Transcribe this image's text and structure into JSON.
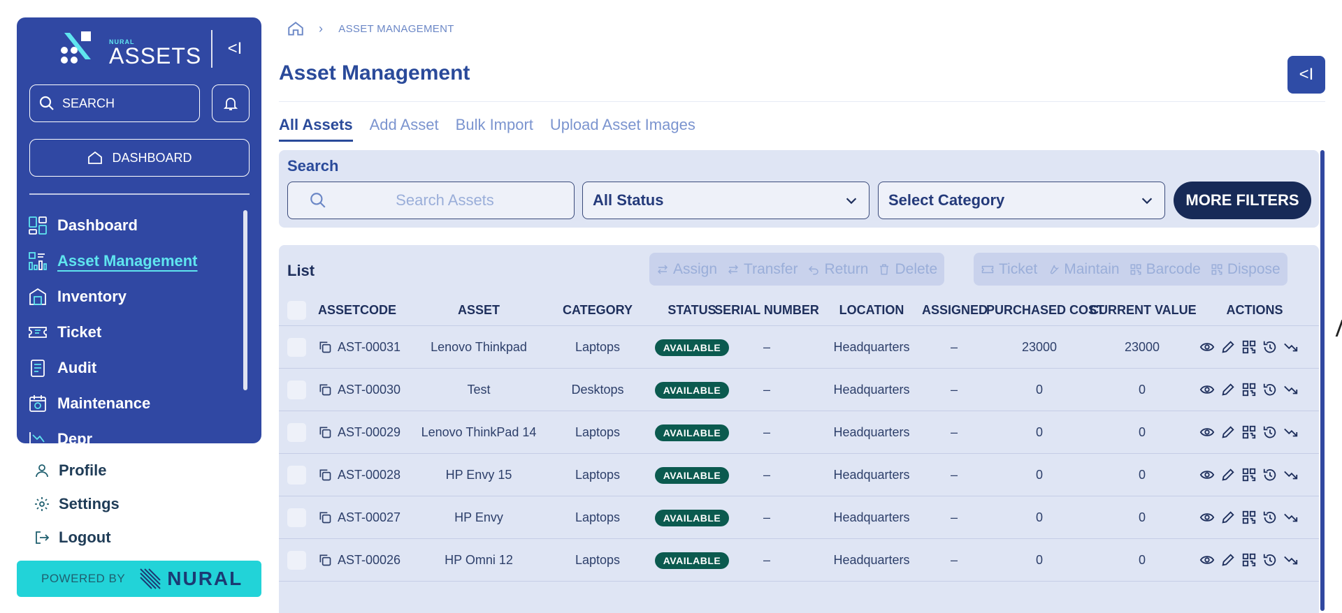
{
  "sidebar": {
    "logo_small": "NURAL",
    "logo_big": "ASSETS",
    "collapse_icon": "<I",
    "search_label": "SEARCH",
    "dashboard_button": "DASHBOARD",
    "items": [
      {
        "label": "Dashboard",
        "icon": "dashboard-icon"
      },
      {
        "label": "Asset Management",
        "icon": "asset-management-icon",
        "active": true
      },
      {
        "label": "Inventory",
        "icon": "inventory-icon"
      },
      {
        "label": "Ticket",
        "icon": "ticket-icon"
      },
      {
        "label": "Audit",
        "icon": "audit-icon"
      },
      {
        "label": "Maintenance",
        "icon": "maintenance-icon"
      },
      {
        "label": "Depr",
        "icon": "depreciation-icon"
      }
    ]
  },
  "bottom_links": [
    {
      "label": "Profile",
      "icon": "user-icon"
    },
    {
      "label": "Settings",
      "icon": "gear-icon"
    },
    {
      "label": "Logout",
      "icon": "logout-icon"
    }
  ],
  "powered": {
    "label": "POWERED BY",
    "brand": "NURAL"
  },
  "breadcrumb": {
    "current": "ASSET MANAGEMENT"
  },
  "page_title": "Asset Management",
  "top_right_icon": "<I",
  "tabs": [
    {
      "label": "All Assets",
      "active": true
    },
    {
      "label": "Add Asset"
    },
    {
      "label": "Bulk Import"
    },
    {
      "label": "Upload Asset Images"
    }
  ],
  "search": {
    "label": "Search",
    "placeholder": "Search Assets",
    "status_select": "All Status",
    "category_select": "Select Category",
    "more_filters": "MORE FILTERS"
  },
  "list": {
    "label": "List",
    "toolbar_a": [
      "Assign",
      "Transfer",
      "Return",
      "Delete"
    ],
    "toolbar_b": [
      "Ticket",
      "Maintain",
      "Barcode",
      "Dispose"
    ],
    "columns": [
      "ASSETCODE",
      "ASSET",
      "CATEGORY",
      "STATUS",
      "SERIAL NUMBER",
      "LOCATION",
      "ASSIGNED",
      "PURCHASED COST",
      "CURRENT VALUE",
      "ACTIONS"
    ],
    "rows": [
      {
        "code": "AST-00031",
        "asset": "Lenovo Thinkpad",
        "category": "Laptops",
        "status": "AVAILABLE",
        "serial": "–",
        "location": "Headquarters",
        "assigned": "–",
        "purchased": "23000",
        "current": "23000"
      },
      {
        "code": "AST-00030",
        "asset": "Test",
        "category": "Desktops",
        "status": "AVAILABLE",
        "serial": "–",
        "location": "Headquarters",
        "assigned": "–",
        "purchased": "0",
        "current": "0"
      },
      {
        "code": "AST-00029",
        "asset": "Lenovo ThinkPad 14",
        "category": "Laptops",
        "status": "AVAILABLE",
        "serial": "–",
        "location": "Headquarters",
        "assigned": "–",
        "purchased": "0",
        "current": "0"
      },
      {
        "code": "AST-00028",
        "asset": "HP Envy 15",
        "category": "Laptops",
        "status": "AVAILABLE",
        "serial": "–",
        "location": "Headquarters",
        "assigned": "–",
        "purchased": "0",
        "current": "0"
      },
      {
        "code": "AST-00027",
        "asset": "HP Envy",
        "category": "Laptops",
        "status": "AVAILABLE",
        "serial": "–",
        "location": "Headquarters",
        "assigned": "–",
        "purchased": "0",
        "current": "0"
      },
      {
        "code": "AST-00026",
        "asset": "HP Omni 12",
        "category": "Laptops",
        "status": "AVAILABLE",
        "serial": "–",
        "location": "Headquarters",
        "assigned": "–",
        "purchased": "0",
        "current": "0"
      }
    ]
  },
  "colors": {
    "sidebar": "#3048a3",
    "accent": "#22d3d8",
    "primary": "#2a4a9a",
    "badge": "#0b5a4f",
    "card": "#dfe5f4"
  }
}
